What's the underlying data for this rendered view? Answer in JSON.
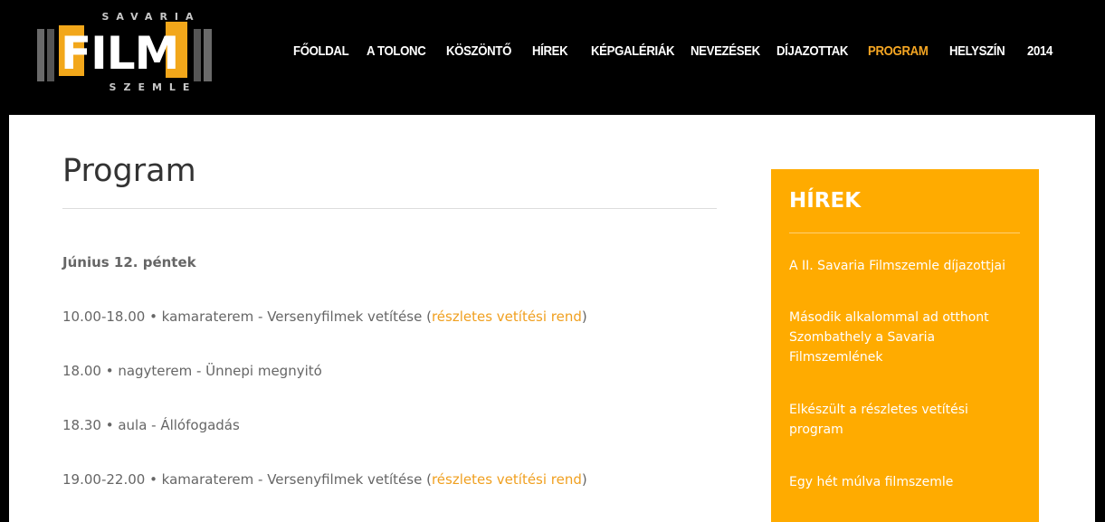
{
  "logo": {
    "top": "SAVARIA",
    "main": "FILM",
    "bottom": "SZEMLE"
  },
  "nav": [
    {
      "label": "FŐOLDAL",
      "active": false
    },
    {
      "label": "A TOLONC",
      "active": false
    },
    {
      "label": "KÖSZÖNTŐ",
      "active": false
    },
    {
      "label": "HÍREK",
      "active": false
    },
    {
      "label": "KÉPGALÉRIÁK",
      "active": false
    },
    {
      "label": "NEVEZÉSEK",
      "active": false
    },
    {
      "label": "DÍJAZOTTAK",
      "active": false
    },
    {
      "label": "PROGRAM",
      "active": true
    },
    {
      "label": "HELYSZÍN",
      "active": false
    },
    {
      "label": "2014",
      "active": false
    }
  ],
  "page": {
    "title": "Program",
    "day": "Június 12. péntek",
    "entries": [
      {
        "text": "10.00-18.00 • kamaraterem - Versenyfilmek vetítése (",
        "link": "részletes vetítési rend",
        "after": ")"
      },
      {
        "text": "18.00 • nagyterem - Ünnepi megnyitó",
        "link": "",
        "after": ""
      },
      {
        "text": "18.30 • aula - Állófogadás",
        "link": "",
        "after": ""
      },
      {
        "text": "19.00-22.00 • kamaraterem - Versenyfilmek vetítése (",
        "link": "részletes vetítési rend",
        "after": ")"
      }
    ]
  },
  "sidebar": {
    "title": "HÍREK",
    "items": [
      "A II. Savaria Filmszemle díjazottjai",
      "Második alkalommal ad otthont Szombathely a Savaria Filmszemlének",
      "Elkészült a részletes vetítési program",
      "Egy hét múlva filmszemle"
    ]
  },
  "colors": {
    "accent": "#f5a623",
    "sidebar_bg": "#ffab00",
    "header_bg": "#000000"
  }
}
